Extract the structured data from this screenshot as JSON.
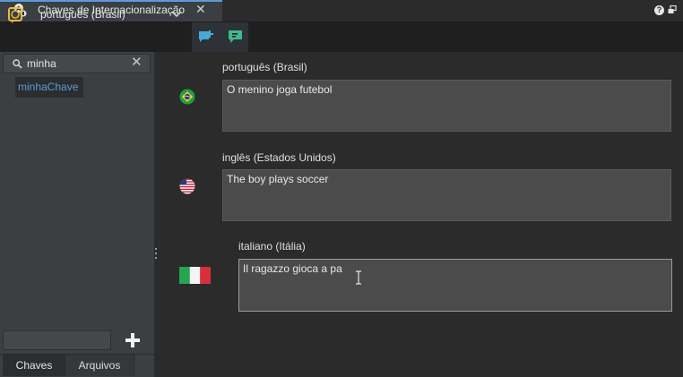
{
  "tab": {
    "title": "Chaves de Internacionalização",
    "close_glyph": "✕"
  },
  "window": {
    "help_glyph": "?"
  },
  "toolbar": {
    "locale_value": "português (Brasil)"
  },
  "search": {
    "value": "minha",
    "clear_glyph": "✕"
  },
  "keys": [
    {
      "label": "minhaChave"
    }
  ],
  "new_key": {
    "value": ""
  },
  "bottom_tabs": [
    {
      "label": "Chaves",
      "active": true
    },
    {
      "label": "Arquivos",
      "active": false
    }
  ],
  "translations": [
    {
      "language": "português (Brasil)",
      "flag_icon": "brazil-flag-icon",
      "text": "O menino joga futebol"
    },
    {
      "language": "inglês (Estados Unidos)",
      "flag_icon": "usa-flag-icon",
      "text": "The boy plays soccer"
    },
    {
      "language": "italiano (Itália)",
      "flag_icon": "italy-flag-icon",
      "text": "Il ragazzo gioca a pa"
    }
  ],
  "colors": {
    "accent": "#5a9bd8",
    "locale_icon": "#e8b93a",
    "add_translation_icon": "#4aa8d8",
    "chat_icon": "#3fb98a"
  }
}
